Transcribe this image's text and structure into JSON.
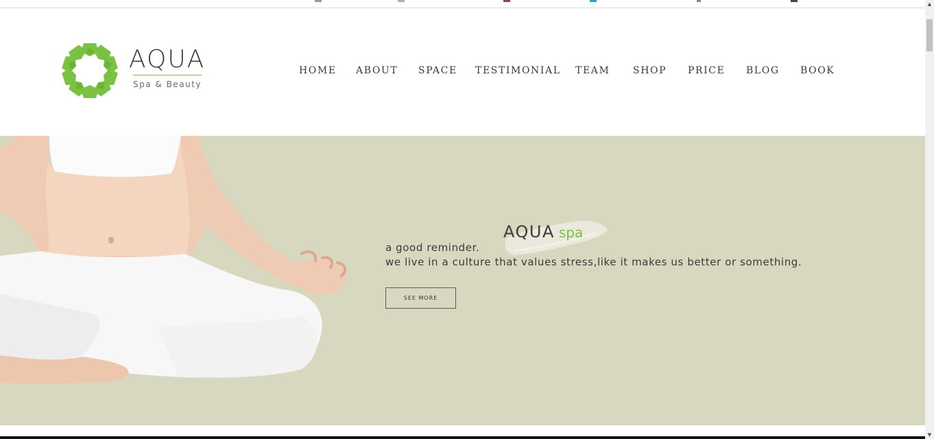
{
  "header": {
    "logo": {
      "title": "AQUA",
      "subtitle": "Spa & Beauty",
      "icon": "lotus-logo-icon",
      "color": "#7cc242"
    },
    "nav": [
      {
        "label": "HOME"
      },
      {
        "label": "ABOUT"
      },
      {
        "label": "SPACE"
      },
      {
        "label": "TESTIMONIAL"
      },
      {
        "label": "TEAM"
      },
      {
        "label": "SHOP"
      },
      {
        "label": "PRICE"
      },
      {
        "label": "BLOG"
      },
      {
        "label": "BOOK"
      }
    ]
  },
  "hero": {
    "background": "#d8d8c0",
    "brand_primary": "AQUA",
    "brand_accent": "spa",
    "accent_color": "#7cc242",
    "line1": "a good reminder.",
    "line2": "we live in a culture that values stress,like it makes us better or something.",
    "button_label": "SEE MORE",
    "image": "yoga-woman-meditating-image"
  },
  "scrollbar": {
    "up_icon": "scroll-up-arrow-icon",
    "down_icon": "scroll-down-arrow-icon"
  }
}
